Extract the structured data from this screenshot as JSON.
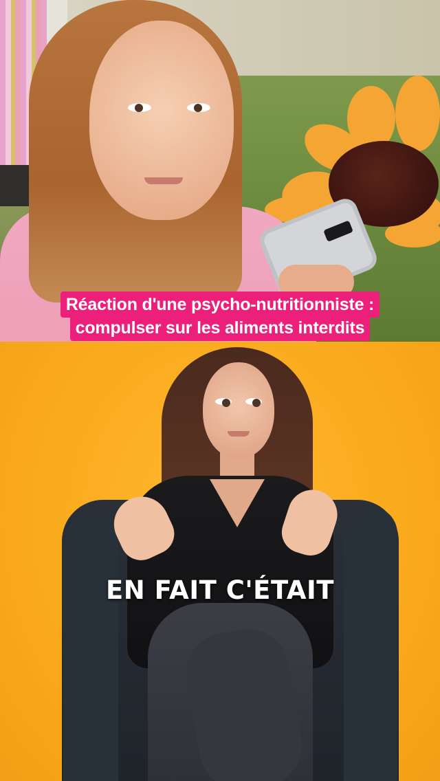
{
  "video": {
    "title_caption_line1": "Réaction d'une psycho-nutritionniste :",
    "title_caption_line2": "compulser sur les aliments interdits",
    "subtitle": "EN FAIT C'ÉTAIT"
  },
  "colors": {
    "caption_bg": "#ec1f7a",
    "bottom_background": "#f9a91b"
  }
}
